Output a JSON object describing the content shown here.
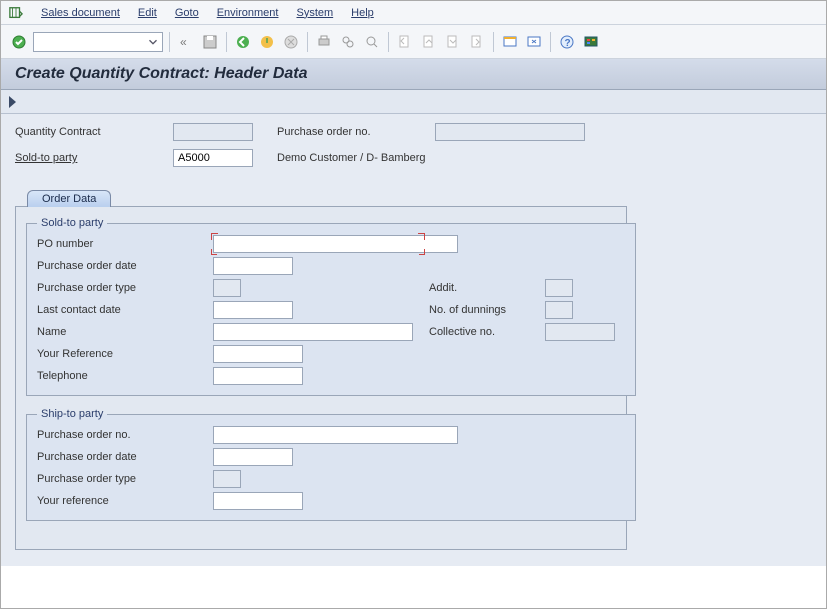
{
  "menu": {
    "items": [
      "Sales document",
      "Edit",
      "Goto",
      "Environment",
      "System",
      "Help"
    ]
  },
  "title": "Create Quantity Contract: Header Data",
  "header": {
    "quantity_contract_label": "Quantity Contract",
    "quantity_contract_value": "",
    "po_no_label": "Purchase order no.",
    "po_no_value": "",
    "soldto_label": "Sold-to party",
    "soldto_value": "A5000",
    "soldto_desc": "Demo Customer / D- Bamberg"
  },
  "tabs": {
    "order_data": "Order Data"
  },
  "sold_to": {
    "legend": "Sold-to party",
    "po_number_label": "PO number",
    "po_number_value": "",
    "po_date_label": "Purchase order date",
    "po_date_value": "",
    "po_type_label": "Purchase order type",
    "po_type_value": "",
    "addit_label": "Addit.",
    "addit_value": "",
    "last_contact_label": "Last contact date",
    "last_contact_value": "",
    "dunnings_label": "No. of dunnings",
    "dunnings_value": "",
    "name_label": "Name",
    "name_value": "",
    "collective_label": "Collective no.",
    "collective_value": "",
    "your_ref_label": "Your Reference",
    "your_ref_value": "",
    "telephone_label": "Telephone",
    "telephone_value": ""
  },
  "ship_to": {
    "legend": "Ship-to party",
    "po_no_label": "Purchase order no.",
    "po_no_value": "",
    "po_date_label": "Purchase order date",
    "po_date_value": "",
    "po_type_label": "Purchase order type",
    "po_type_value": "",
    "your_ref_label": "Your reference",
    "your_ref_value": ""
  }
}
